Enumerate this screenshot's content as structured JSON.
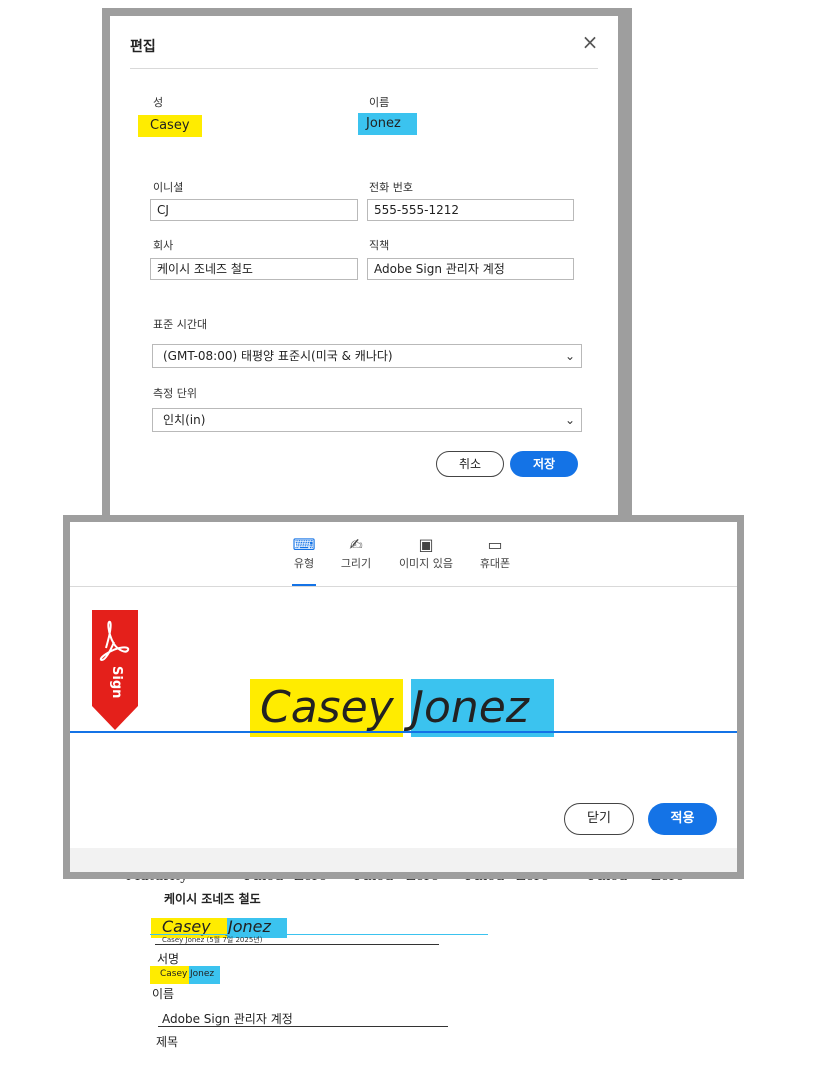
{
  "edit_dialog": {
    "title": "편집",
    "close_glyph": "×",
    "fields": {
      "last_name": {
        "label": "성",
        "value": "Casey"
      },
      "first_name": {
        "label": "이름",
        "value": "Jonez"
      },
      "initials": {
        "label": "이니셜",
        "value": "CJ"
      },
      "phone": {
        "label": "전화 번호",
        "value": "555-555-1212"
      },
      "company": {
        "label": "회사",
        "value": "케이시 조네즈 철도"
      },
      "title": {
        "label": "직책",
        "value": "Adobe Sign 관리자 계정"
      },
      "timezone": {
        "label": "표준 시간대",
        "value": "(GMT-08:00) 태평양 표준시(미국 & 캐나다)"
      },
      "unit": {
        "label": "측정 단위",
        "value": "인치(in)"
      }
    },
    "cancel_label": "취소",
    "save_label": "저장",
    "chevron_glyph": "⌄"
  },
  "signature_panel": {
    "tabs": [
      {
        "label": "유형",
        "icon": "keyboard-icon",
        "glyph": "⌨"
      },
      {
        "label": "그리기",
        "icon": "pen-icon",
        "glyph": "✍"
      },
      {
        "label": "이미지 있음",
        "icon": "image-icon",
        "glyph": "▣"
      },
      {
        "label": "휴대폰",
        "icon": "mobile-icon",
        "glyph": "▭"
      }
    ],
    "active_tab": "유형",
    "bookmark_label": "Sign",
    "signature_first": "Casey",
    "signature_last": "Jonez",
    "close_label": "닫기",
    "apply_label": "적용"
  },
  "document": {
    "table_header": [
      "Maturity",
      "Fixed",
      "Zero",
      "Fixed",
      "Zero",
      "Fixed",
      "Zero",
      "Fixed",
      "Zero"
    ],
    "company": "케이시 조네즈 철도",
    "signature_first": "Casey",
    "signature_last": "Jonez",
    "signature_meta": "Casey Jonez (5월 7일 2025년)",
    "signature_label": "서명",
    "name_first": "Casey",
    "name_last": "Jonez",
    "name_label": "이름",
    "title_value": "Adobe Sign 관리자 계정",
    "title_label": "제목"
  },
  "colors": {
    "highlight_yellow": "#ffec00",
    "highlight_blue": "#3bc3ef",
    "accent_blue": "#1473e6",
    "adobe_red": "#e4201b"
  }
}
